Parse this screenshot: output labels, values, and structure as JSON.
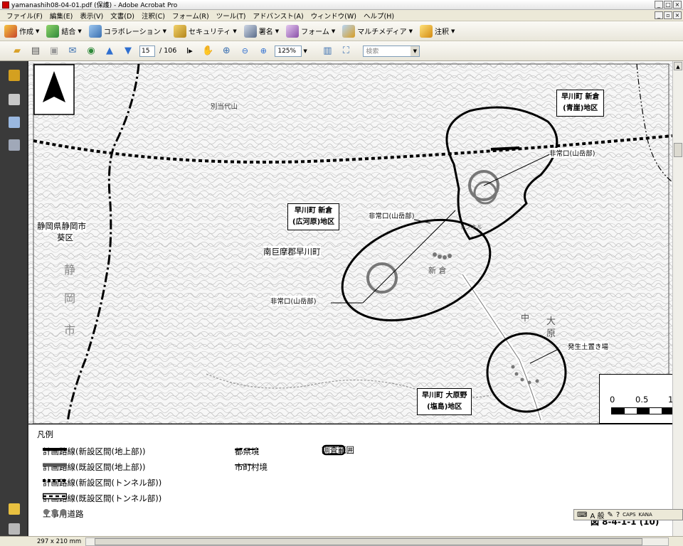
{
  "window": {
    "title": "yamanashih08-04-01.pdf (保護) - Adobe Acrobat Pro"
  },
  "menu": {
    "items": [
      "ファイル(F)",
      "編集(E)",
      "表示(V)",
      "文書(D)",
      "注釈(C)",
      "フォーム(R)",
      "ツール(T)",
      "アドバンスト(A)",
      "ウィンドウ(W)",
      "ヘルプ(H)"
    ]
  },
  "tasks": {
    "create": "作成",
    "combine": "結合",
    "collaborate": "コラボレーション",
    "security": "セキュリティ",
    "sign": "署名",
    "forms": "フォーム",
    "multimedia": "マルチメディア",
    "comment": "注釈"
  },
  "nav": {
    "page_current": "15",
    "page_total": "/ 106",
    "zoom": "125%",
    "search_placeholder": "検索"
  },
  "status": {
    "page_size": "297 x 210 mm"
  },
  "map": {
    "mountain": "別当代山",
    "pref_label_1": "静岡県静岡市",
    "pref_label_2": "葵区",
    "town_label": "南巨摩郡早川町",
    "vertical_chars": [
      "静",
      "岡",
      "市"
    ],
    "shinkura_label": "新 倉",
    "ohara_label_chars": [
      "大",
      "原"
    ],
    "naka_label": "中",
    "area_aogake": [
      "早川町 新倉",
      "(青崖)地区"
    ],
    "area_hirokawara": [
      "早川町 新倉",
      "(広河原)地区"
    ],
    "area_shiojima": [
      "早川町 大原野",
      "(塩島)地区"
    ],
    "emergency_1": "非常口(山岳部)",
    "emergency_2": "非常口(山岳部)",
    "emergency_3": "非常口(山岳部)",
    "spoil_site": "発生土置き場",
    "tunnel_text": "トンネル"
  },
  "legend": {
    "title": "凡例",
    "items": [
      "計画路線(新設区間(地上部))",
      "計画路線(既設区間(地上部))",
      "計画路線(新設区間(トンネル部))",
      "計画路線(既設区間(トンネル部))",
      "工事用道路",
      "都県境",
      "市町村境",
      "調査範囲"
    ]
  },
  "scale": {
    "labels": [
      "0",
      "0.5",
      "1"
    ]
  },
  "figure_caption": "図 8-4-1-1 (10)",
  "ime": {
    "mode": "A 般",
    "caps": "CAPS",
    "kana": "KANA"
  }
}
